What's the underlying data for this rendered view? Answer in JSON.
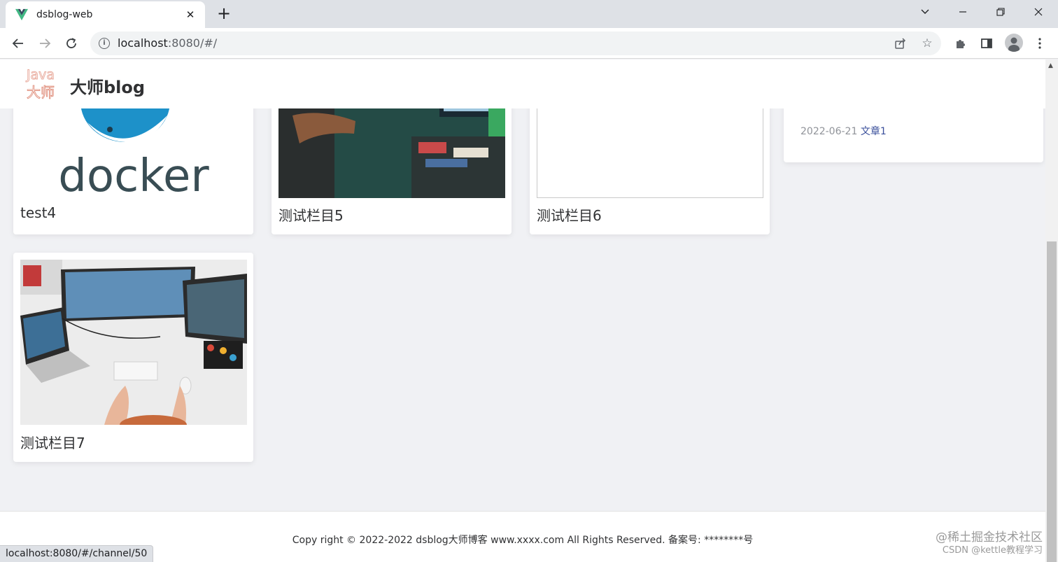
{
  "browser": {
    "tab_title": "dsblog-web",
    "url_host": "localhost",
    "url_path": ":8080/#/",
    "status_url": "localhost:8080/#/channel/50"
  },
  "header": {
    "site_name": "大师blog",
    "logo_text_1": "Java",
    "logo_text_2": "大师"
  },
  "cards": [
    {
      "title": "test4",
      "image": "docker-logo",
      "docker_word": "docker"
    },
    {
      "title": "测试栏目5",
      "image": "photo-person-pointing"
    },
    {
      "title": "测试栏目6",
      "image": "blank"
    },
    {
      "title": "测试栏目7",
      "image": "photo-desk-monitors"
    }
  ],
  "sidebar": {
    "date": "2022-06-21",
    "article": "文章1"
  },
  "footer": {
    "text": "Copy right © 2022-2022 dsblog大师博客 www.xxxx.com All Rights Reserved. 备案号: ********号"
  },
  "watermark": {
    "line1": "@稀土掘金技术社区",
    "line2": "CSDN @kettle教程学习"
  },
  "colors": {
    "accent_link": "#3a4f9b",
    "page_bg": "#f0f1f4"
  }
}
